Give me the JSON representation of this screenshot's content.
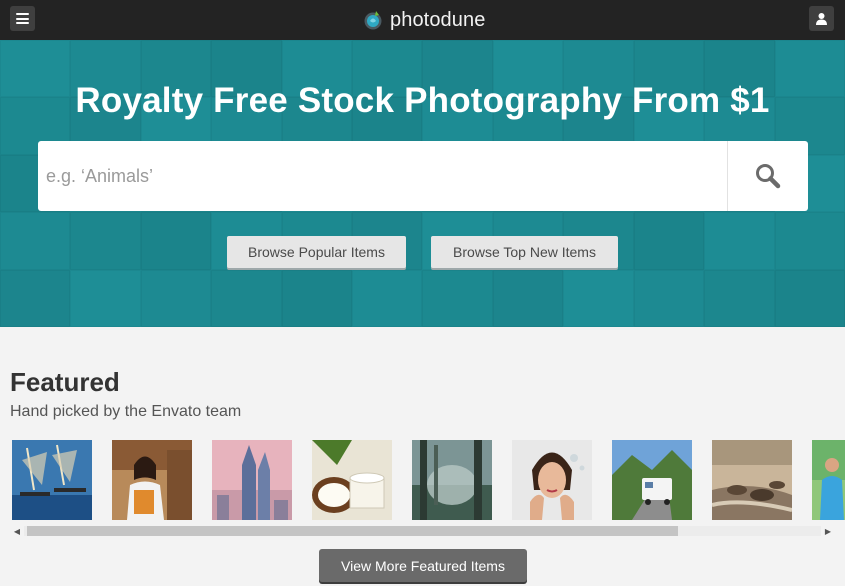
{
  "topbar": {
    "menu_icon": "hamburger-menu-icon",
    "user_icon": "user-icon",
    "logo_text": "photodune"
  },
  "hero": {
    "title": "Royalty Free Stock Photography From $1",
    "search_placeholder": "e.g. ‘Animals’",
    "search_icon": "search-icon",
    "browse_popular_label": "Browse Popular Items",
    "browse_new_label": "Browse Top New Items",
    "color": "#1e8e96"
  },
  "featured": {
    "title": "Featured",
    "subtitle": "Hand picked by the Envato team",
    "items": [
      {
        "name": "fishermen-boats"
      },
      {
        "name": "woman-with-folder"
      },
      {
        "name": "city-skyline"
      },
      {
        "name": "coconut-cream"
      },
      {
        "name": "foggy-forest"
      },
      {
        "name": "woman-portrait"
      },
      {
        "name": "rv-on-road"
      },
      {
        "name": "animal-stampede"
      },
      {
        "name": "person-in-blue"
      }
    ],
    "view_more_label": "View More Featured Items"
  }
}
